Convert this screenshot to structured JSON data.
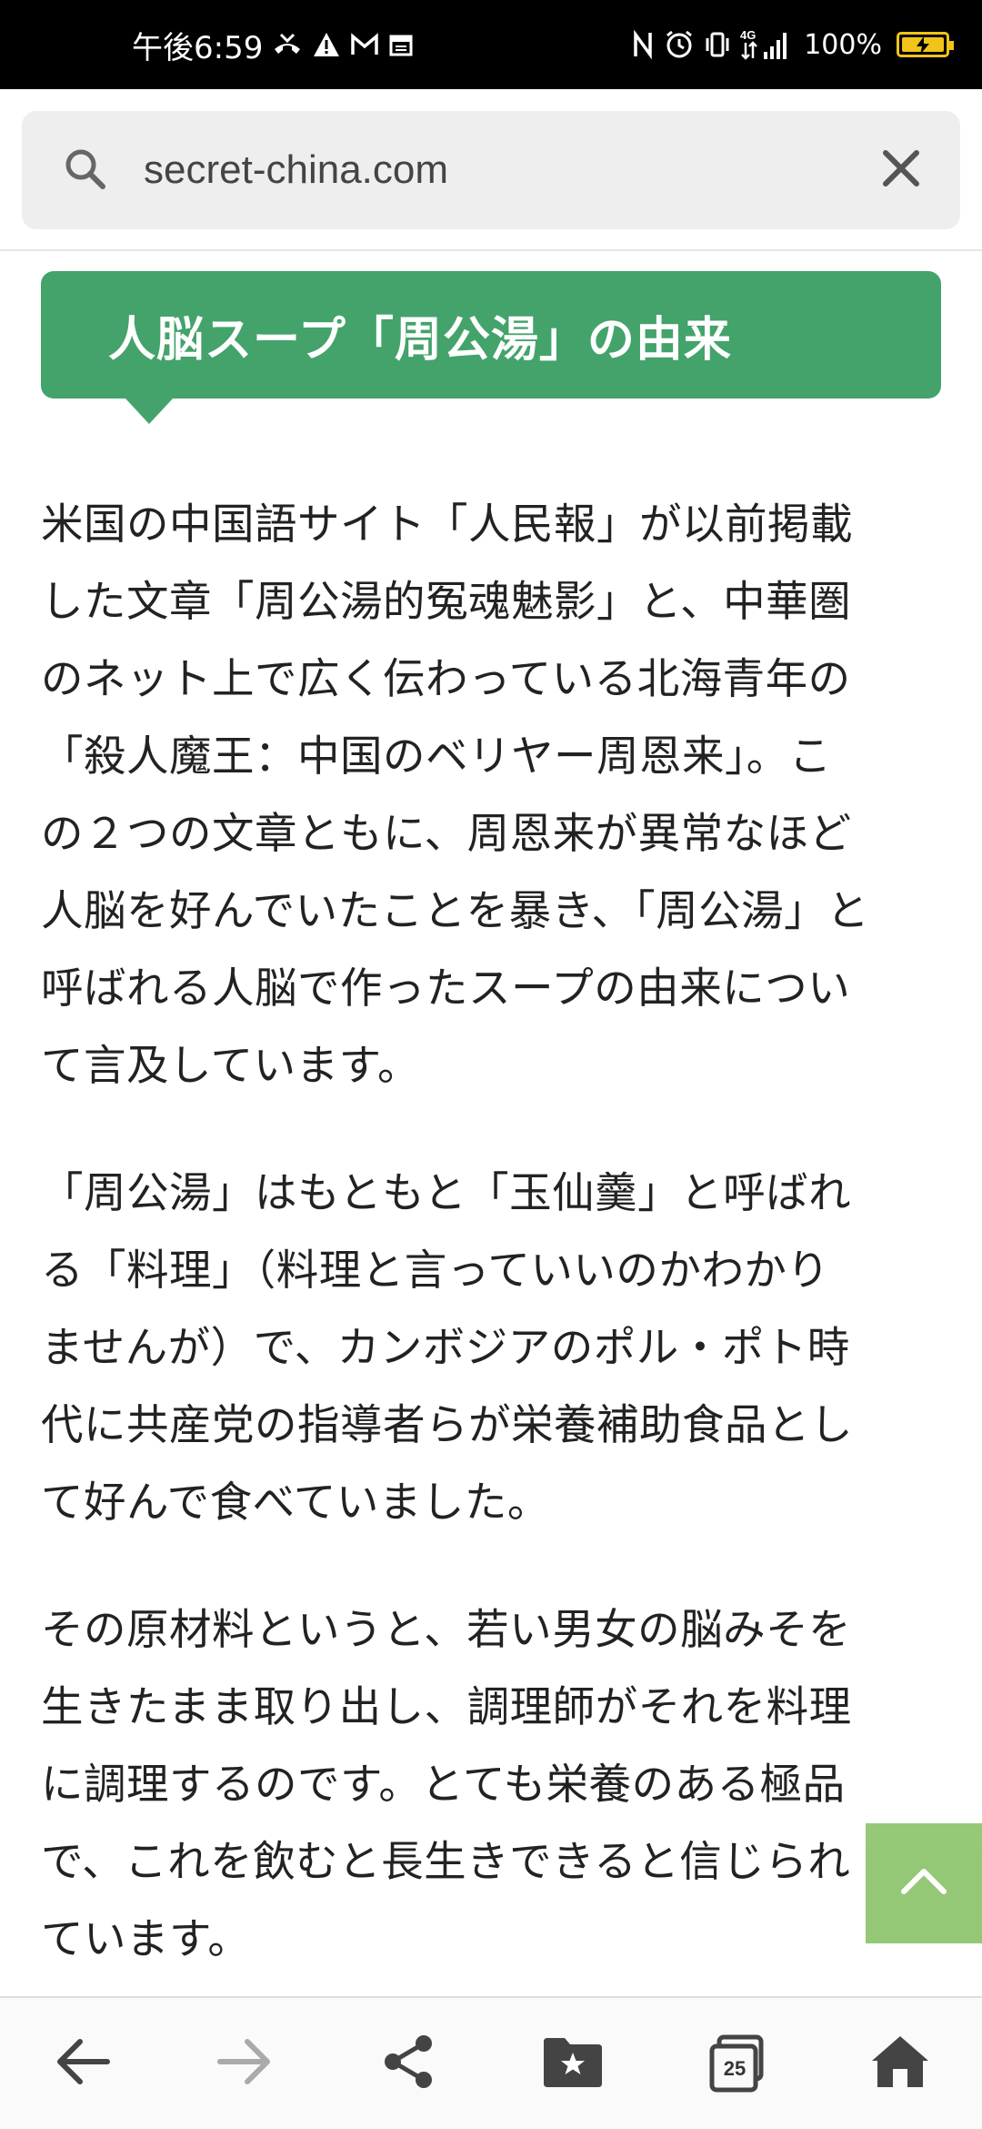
{
  "status_bar": {
    "time": "午後6:59",
    "battery": "100%",
    "network": "4G"
  },
  "search": {
    "url": "secret-china.com"
  },
  "article": {
    "heading": "人脳スープ「周公湯」の由来",
    "paragraphs": [
      [
        "米国の中国語サイト「人民報」が以前掲載",
        "した文章「周公湯的冤魂魅影」と、中華圏",
        "のネット上で広く伝わっている北海青年の",
        "「殺人魔王：中国のベリヤー周恩来」。こ",
        "の２つの文章ともに、周恩来が異常なほど",
        "人脳を好んでいたことを暴き、「周公湯」と",
        "呼ばれる人脳で作ったスープの由来につい",
        "て言及しています。"
      ],
      [
        "「周公湯」はもともと「玉仙羹」と呼ばれ",
        "る「料理」（料理と言っていいのかわかり",
        "ませんが）で、カンボジアのポル・ポト時",
        "代に共産党の指導者らが栄養補助食品とし",
        "て好んで食べていました。"
      ],
      [
        "その原材料というと、若い男女の脳みそを",
        "生きたまま取り出し、調理師がそれを料理",
        "に調理するのです。とても栄養のある極品",
        "で、これを飲むと長生きできると信じられ",
        "ています。"
      ]
    ]
  },
  "bottom_nav": {
    "tab_count": "25"
  },
  "colors": {
    "heading_bg": "#43a36b",
    "back_to_top_bg": "#8cc46b",
    "status_bar_bg": "#000000"
  },
  "icons": [
    "search-icon",
    "close-icon",
    "back-arrow-icon",
    "forward-arrow-icon",
    "share-icon",
    "bookmark-folder-icon",
    "tabs-icon",
    "home-icon",
    "chevron-up-icon"
  ]
}
